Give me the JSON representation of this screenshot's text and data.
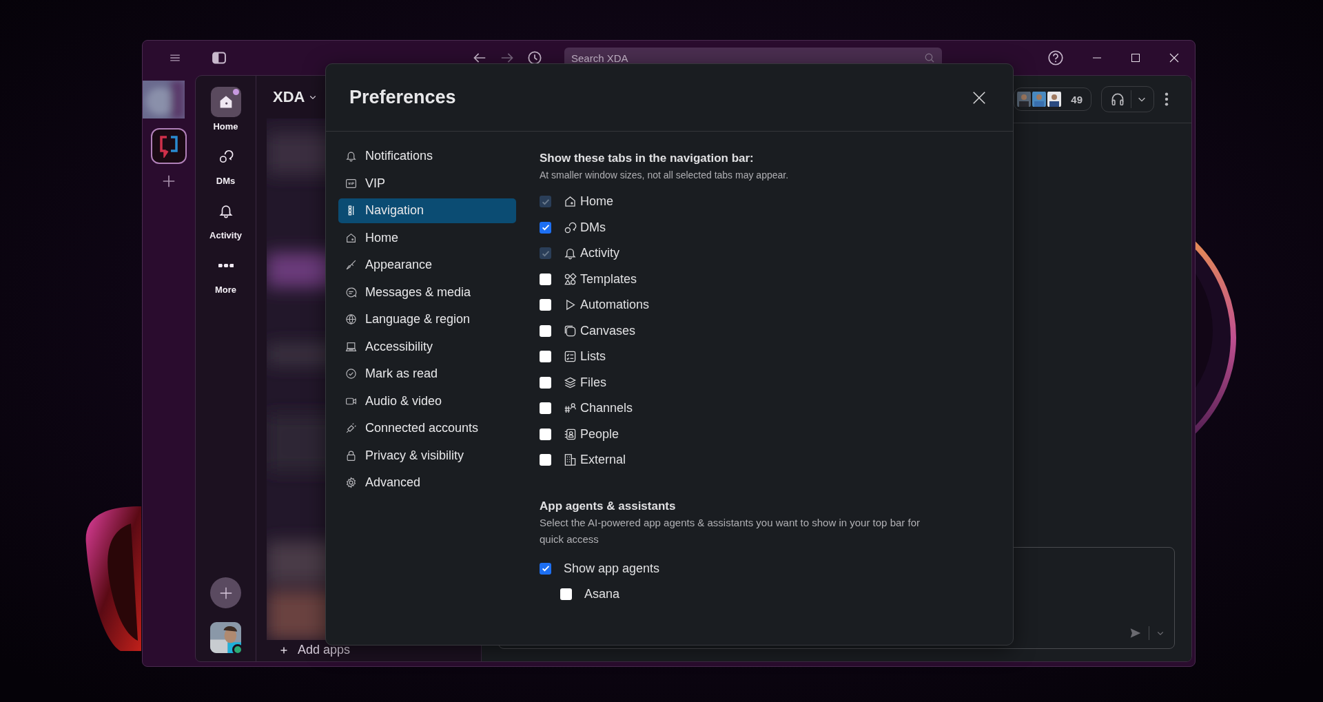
{
  "titlebar": {
    "search": {
      "placeholder": "Search XDA"
    }
  },
  "nav": [
    {
      "label": "Home",
      "selected": true,
      "unread": true
    },
    {
      "label": "DMs",
      "selected": false,
      "unread": false
    },
    {
      "label": "Activity",
      "selected": false,
      "unread": false
    },
    {
      "label": "More",
      "selected": false,
      "unread": false
    }
  ],
  "workspace": {
    "name": "XDA"
  },
  "sidebar": {
    "add_apps": "Add apps"
  },
  "header": {
    "member_count": "49"
  },
  "dialog": {
    "title": "Preferences",
    "menu": [
      {
        "label": "Notifications",
        "selected": false
      },
      {
        "label": "VIP",
        "selected": false
      },
      {
        "label": "Navigation",
        "selected": true
      },
      {
        "label": "Home",
        "selected": false
      },
      {
        "label": "Appearance",
        "selected": false
      },
      {
        "label": "Messages & media",
        "selected": false
      },
      {
        "label": "Language & region",
        "selected": false
      },
      {
        "label": "Accessibility",
        "selected": false
      },
      {
        "label": "Mark as read",
        "selected": false
      },
      {
        "label": "Audio & video",
        "selected": false
      },
      {
        "label": "Connected accounts",
        "selected": false
      },
      {
        "label": "Privacy & visibility",
        "selected": false
      },
      {
        "label": "Advanced",
        "selected": false
      }
    ],
    "tabs_section": {
      "heading": "Show these tabs in the navigation bar:",
      "note": "At smaller window sizes, not all selected tabs may appear.",
      "tabs": [
        {
          "label": "Home",
          "checked": true,
          "disabled": true
        },
        {
          "label": "DMs",
          "checked": true,
          "disabled": false
        },
        {
          "label": "Activity",
          "checked": true,
          "disabled": true
        },
        {
          "label": "Templates",
          "checked": false,
          "disabled": false
        },
        {
          "label": "Automations",
          "checked": false,
          "disabled": false
        },
        {
          "label": "Canvases",
          "checked": false,
          "disabled": false
        },
        {
          "label": "Lists",
          "checked": false,
          "disabled": false
        },
        {
          "label": "Files",
          "checked": false,
          "disabled": false
        },
        {
          "label": "Channels",
          "checked": false,
          "disabled": false
        },
        {
          "label": "People",
          "checked": false,
          "disabled": false
        },
        {
          "label": "External",
          "checked": false,
          "disabled": false
        }
      ]
    },
    "agents_section": {
      "heading": "App agents & assistants",
      "note": "Select the AI-powered app agents & assistants you want to show in your top bar for quick access",
      "options": [
        {
          "label": "Show app agents",
          "checked": true,
          "children": [
            {
              "label": "Asana",
              "checked": false
            }
          ]
        }
      ]
    }
  }
}
